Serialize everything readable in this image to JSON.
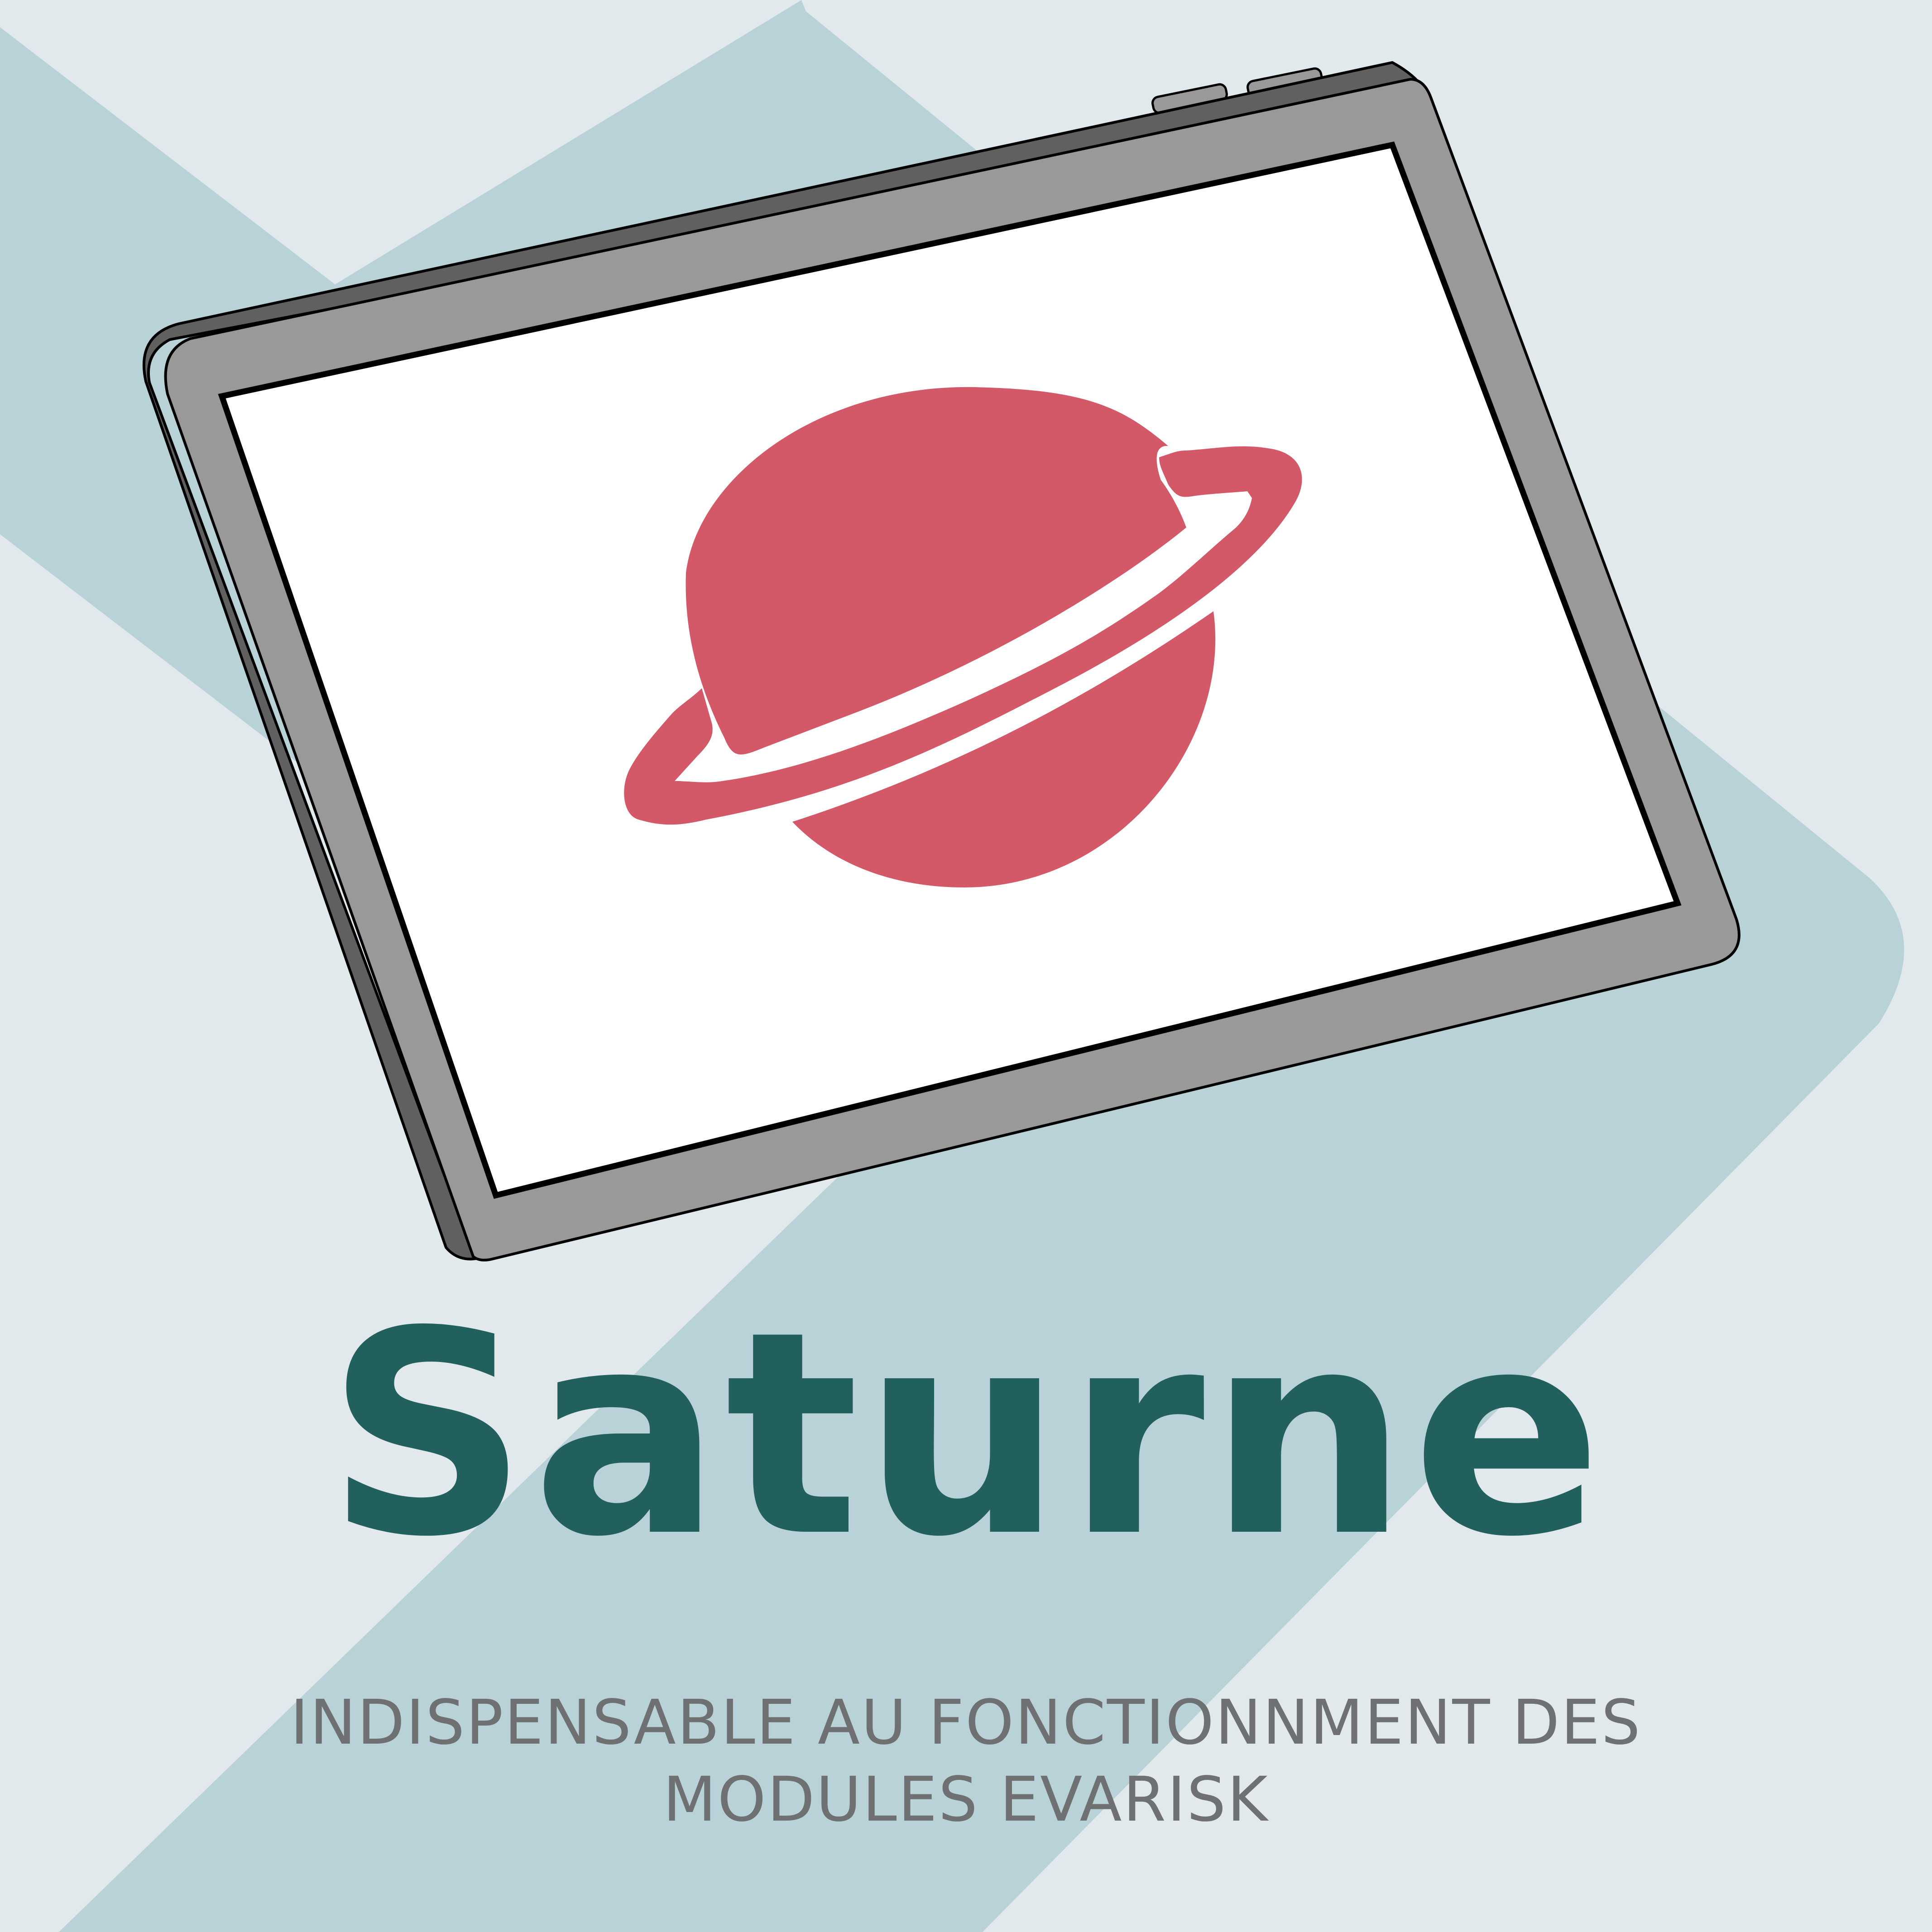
{
  "colors": {
    "background": "#e1e9ed",
    "ribbon": "#b8d2d8",
    "tablet_frame": "#999999",
    "tablet_side": "#606060",
    "screen": "#ffffff",
    "logo": "#d35969",
    "title": "#22605e",
    "subtitle": "#6f7072"
  },
  "logo": {
    "icon": "saturn-planet-icon"
  },
  "title": "Saturne",
  "subtitle": {
    "line1": "INDISPENSABLE AU FONCTIONNMENT DES",
    "line2": "MODULES EVARISK"
  }
}
